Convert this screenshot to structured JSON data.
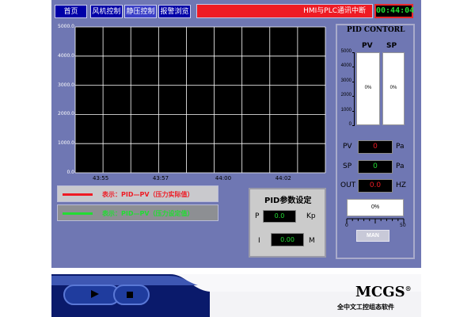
{
  "nav": {
    "home": "首页",
    "fan": "风机控制",
    "static": "静压控制",
    "alarm_browse": "报警浏览"
  },
  "alarm_message": "HMI与PLC通讯中断",
  "clock": "00:44:04",
  "chart_data": {
    "type": "line",
    "title": "",
    "xlabel": "",
    "ylabel": "",
    "ylim": [
      0,
      5000
    ],
    "y_ticks": [
      "5000.0",
      "4000.0",
      "3000.0",
      "2000.0",
      "1000.0",
      "0.0"
    ],
    "x_ticks": [
      "43:55",
      "43:57",
      "44:00",
      "44:02"
    ],
    "series": [],
    "grid": true,
    "background": "#000000",
    "grid_color": "#ffffff"
  },
  "legend": {
    "pv_text": "表示：PID—PV（压力实际值）",
    "sp_text": "表示：PID—PV（压力设定值）",
    "pv_color": "#ee1b24",
    "sp_color": "#22dd33"
  },
  "pid_setting": {
    "title": "PID参数设定",
    "p_label": "P",
    "p_value": "0.0",
    "p_unit": "Kp",
    "i_label": "I",
    "i_value": "0.00",
    "i_unit": "M"
  },
  "pid_control": {
    "title": "PID CONTORL",
    "pv_header": "PV",
    "sp_header": "SP",
    "bar_ticks": [
      "5000",
      "4000",
      "3000",
      "2000",
      "1000",
      "0"
    ],
    "pv_bar_text": "0%",
    "sp_bar_text": "0%",
    "pv_label": "PV",
    "pv_value": "0",
    "pv_unit": "Pa",
    "sp_label": "SP",
    "sp_value": "0",
    "sp_unit": "Pa",
    "out_label": "OUT",
    "out_value": "0.0",
    "out_unit": "HZ",
    "hbar_text": "0%",
    "hbar_min": "0",
    "hbar_max": "50",
    "man_button": "MAN"
  },
  "brand": {
    "name": "MCGS",
    "reg": "®",
    "subtitle": "全中文工控组态软件"
  },
  "colors": {
    "panel": "#6f77b3",
    "nav_blue": "#0000a8",
    "alarm_red": "#ee1b24",
    "value_green": "#22dd33",
    "value_red": "#ee1b24"
  }
}
